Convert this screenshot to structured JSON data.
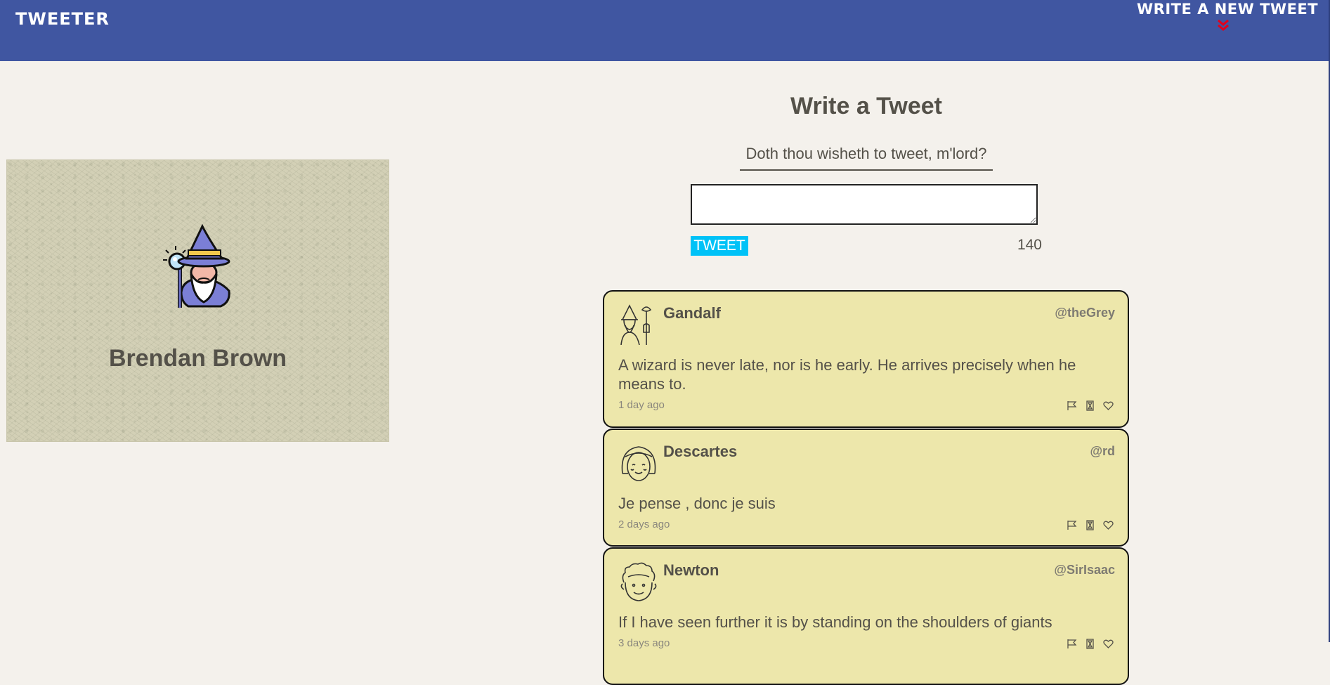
{
  "nav": {
    "brand": "TWEETER",
    "compose_toggle": "WRITE A NEW TWEET",
    "chevron_icon": "double-chevron-down-icon",
    "chevron_color": "#e3001b",
    "background": "#4056a1"
  },
  "profile": {
    "name": "Brendan Brown",
    "avatar_icon": "wizard-avatar-icon"
  },
  "compose": {
    "title": "Write a Tweet",
    "label": "Doth thou wisheth to tweet, m'lord?",
    "input_value": "",
    "submit_label": "TWEET",
    "submit_color": "#00c2f7",
    "counter": "140"
  },
  "tweets": [
    {
      "name": "Gandalf",
      "handle": "@theGrey",
      "avatar_icon": "wizard-line-avatar-icon",
      "text": "A wizard is never late, nor is he early. He arrives precisely when he means to.",
      "time": "1 day ago",
      "actions": [
        "flag-icon",
        "retweet-icon",
        "heart-icon"
      ]
    },
    {
      "name": "Descartes",
      "handle": "@rd",
      "avatar_icon": "bob-hair-avatar-icon",
      "text": "Je pense , donc je suis",
      "time": "2 days ago",
      "actions": [
        "flag-icon",
        "retweet-icon",
        "heart-icon"
      ]
    },
    {
      "name": "Newton",
      "handle": "@SirIsaac",
      "avatar_icon": "curly-hair-avatar-icon",
      "text": "If I have seen further it is by standing on the shoulders of giants",
      "time": "3 days ago",
      "actions": [
        "flag-icon",
        "retweet-icon",
        "heart-icon"
      ]
    }
  ]
}
